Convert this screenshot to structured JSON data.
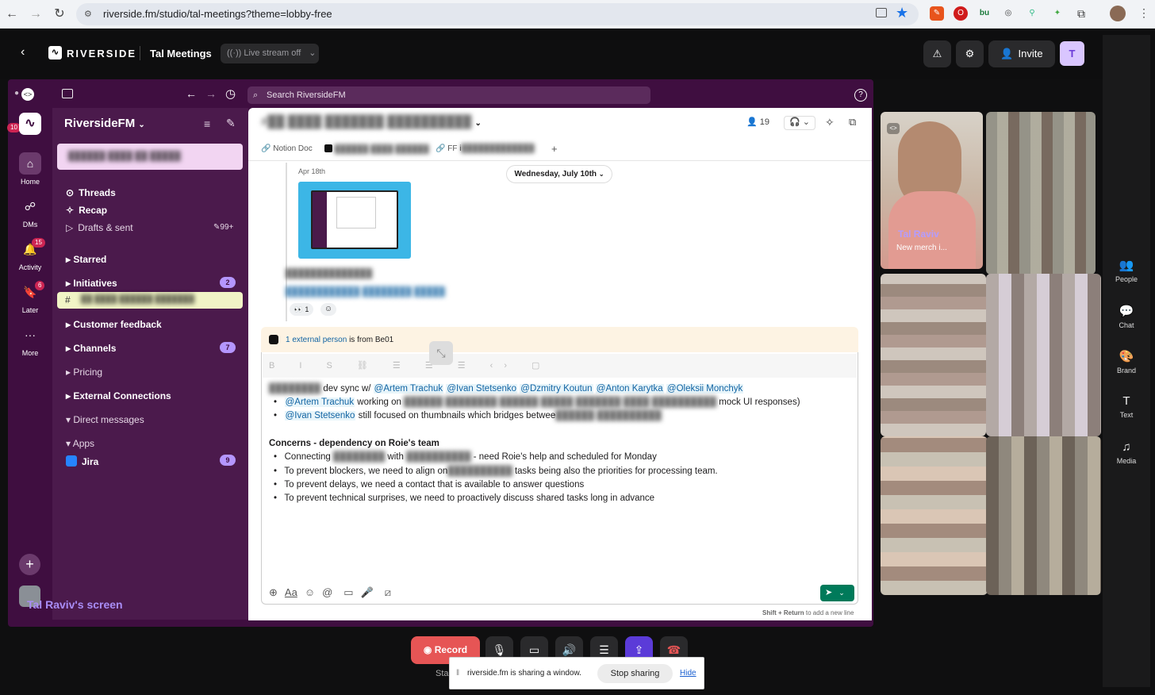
{
  "browser": {
    "url": "riverside.fm/studio/tal-meetings?theme=lobby-free"
  },
  "riverside": {
    "brand": "RIVERSIDE",
    "studio_name": "Tal Meetings",
    "live_stream": "Live stream off",
    "invite_label": "Invite",
    "avatar_initial": "T",
    "screen_label": "Tal Raviv's screen",
    "right_panel": [
      "People",
      "Chat",
      "Brand",
      "Text",
      "Media"
    ],
    "record_label": "Record",
    "share_notice": "riverside.fm is sharing a window.",
    "stop_sharing": "Stop sharing",
    "hide": "Hide",
    "partial_label": "Sta"
  },
  "participant": {
    "name": "Tal Raviv",
    "subtitle": "New merch i..."
  },
  "slack": {
    "search_placeholder": "Search RiversideFM",
    "workspace": "RiversideFM",
    "rail": [
      {
        "label": "Home"
      },
      {
        "label": "DMs"
      },
      {
        "label": "Activity",
        "badge": "15"
      },
      {
        "label": "Later",
        "badge": "6"
      },
      {
        "label": "More"
      }
    ],
    "rail_badge_top": "10",
    "sidebar": {
      "threads": "Threads",
      "recap": "Recap",
      "drafts": "Drafts & sent",
      "drafts_count": "99+",
      "starred": "Starred",
      "initiatives": "Initiatives",
      "initiatives_count": "2",
      "customer_feedback": "Customer feedback",
      "channels": "Channels",
      "channels_count": "7",
      "pricing": "Pricing",
      "external": "External Connections",
      "direct_messages": "Direct messages",
      "apps": "Apps",
      "jira": "Jira",
      "jira_count": "9"
    },
    "header": {
      "member_count": "19",
      "tab_notion": "Notion Doc",
      "tab_ff": "FF i"
    },
    "date_pill": "Wednesday, July 10th",
    "apr_label": "Apr 18th",
    "reaction_count": "1",
    "external_banner": {
      "link": "1 external person",
      "rest": "is from Be01"
    },
    "message": {
      "line1_prefix": "dev sync w/",
      "mentions1": [
        "@Artem Trachuk",
        "@Ivan Stetsenko",
        "@Dzmitry Koutun",
        "@Anton Karytka",
        "@Oleksii Monchyk"
      ],
      "bullet1_mention": "@Artem Trachuk",
      "bullet1_text": "working on",
      "bullet1_end": "mock UI responses)",
      "bullet2_mention": "@Ivan Stetsenko",
      "bullet2_text": "still focused on thumbnails which bridges betwee",
      "concerns_title": "Concerns - dependency on Roie's team",
      "concerns": [
        "Connecting",
        "with",
        "- need Roie's help and scheduled for Monday",
        "To prevent blockers, we need to align on",
        "tasks being also the priorities for processing team.",
        "To prevent delays, we need a contact that is available to answer questions",
        "To prevent technical surprises, we need to proactively discuss shared tasks long in advance"
      ]
    },
    "composer_hint": {
      "bold": "Shift + Return",
      "rest": "to add a new line"
    }
  }
}
